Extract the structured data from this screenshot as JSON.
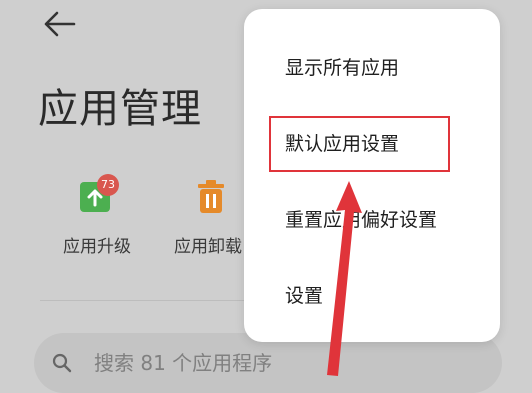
{
  "header": {
    "title": "应用管理",
    "back_icon": "arrow-left-icon"
  },
  "features": [
    {
      "label": "应用升级",
      "icon": "upgrade-icon",
      "badge": "73",
      "color": "#4caf50"
    },
    {
      "label": "应用卸载",
      "icon": "trash-icon",
      "color": "#e58a2a"
    }
  ],
  "search": {
    "placeholder": "搜索 81 个应用程序"
  },
  "menu": {
    "items": [
      {
        "label": "显示所有应用"
      },
      {
        "label": "默认应用设置"
      },
      {
        "label": "重置应用偏好设置"
      },
      {
        "label": "设置"
      }
    ]
  },
  "annotation": {
    "highlighted_item": "默认应用设置",
    "color": "#e0343a"
  }
}
